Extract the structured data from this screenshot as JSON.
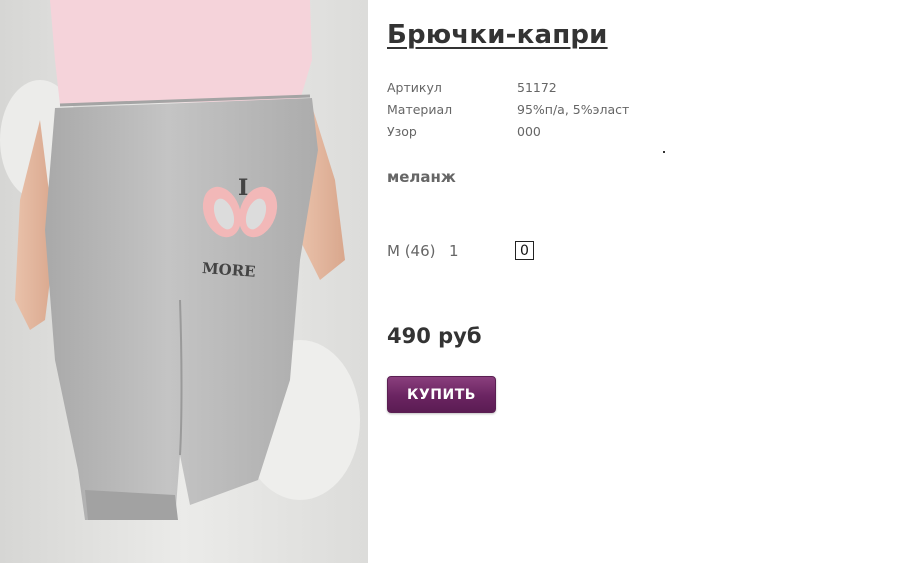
{
  "product": {
    "title": "Брючки-капри",
    "image_alt": "Брючки-капри",
    "image_print": {
      "top": "I",
      "bottom": "MORE"
    },
    "specs": [
      {
        "label": "Артикул",
        "value": "51172"
      },
      {
        "label": "Материал",
        "value": "95%п/а, 5%эласт"
      },
      {
        "label": "Узор",
        "value": "000"
      }
    ],
    "color": "меланж",
    "size": {
      "label": "M (46)",
      "stock": "1",
      "quantity": "0"
    },
    "price": "490 руб",
    "buy_label": "КУПИТЬ"
  },
  "colors": {
    "button": "#6a2461",
    "title": "#333333",
    "text": "#666666",
    "pants": "#b9b9b9",
    "shirt": "#f5d3da"
  }
}
